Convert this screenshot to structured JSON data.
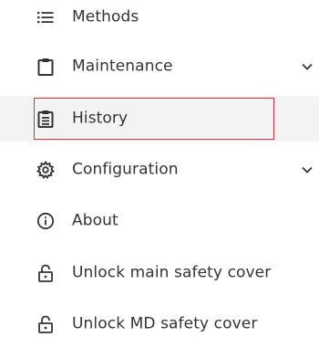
{
  "menu": {
    "items": [
      {
        "label": "Methods",
        "icon": "list-icon",
        "expandable": false
      },
      {
        "label": "Maintenance",
        "icon": "clipboard-icon",
        "expandable": true
      },
      {
        "label": "History",
        "icon": "history-document-icon",
        "expandable": false,
        "selected": true
      },
      {
        "label": "Configuration",
        "icon": "gear-icon",
        "expandable": true
      },
      {
        "label": "About",
        "icon": "info-icon",
        "expandable": false
      },
      {
        "label": "Unlock main safety cover",
        "icon": "unlock-icon",
        "expandable": false
      },
      {
        "label": "Unlock MD safety cover",
        "icon": "unlock-icon",
        "expandable": false
      }
    ]
  },
  "colors": {
    "text": "#333333",
    "selected_background": "#f3f3f3",
    "highlight_border": "#d6303c"
  }
}
